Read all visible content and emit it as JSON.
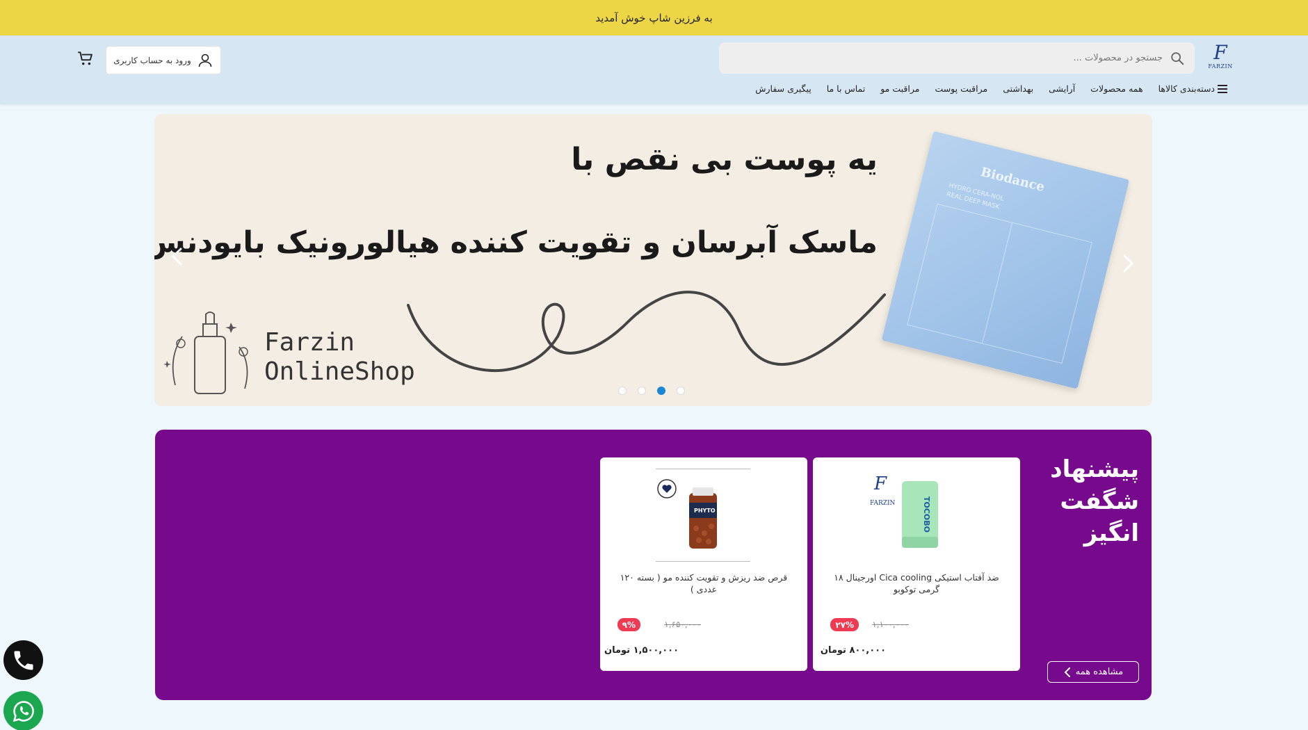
{
  "topbar": {
    "welcome": "به فرزین شاپ خوش آمدید"
  },
  "header": {
    "logo_mark": "F",
    "logo_text": "FARZIN",
    "search_placeholder": "جستجو در محصولات ...",
    "login_label": "ورود به حساب کاربری"
  },
  "nav": {
    "items": [
      {
        "label": "دسته‌بندی کالاها"
      },
      {
        "label": "همه محصولات"
      },
      {
        "label": "آرایشی"
      },
      {
        "label": "بهداشتی"
      },
      {
        "label": "مراقبت پوست"
      },
      {
        "label": "مراقبت مو"
      },
      {
        "label": "تماس با ما"
      },
      {
        "label": "پیگیری سفارش"
      }
    ]
  },
  "hero": {
    "line1": "یه پوست بی نقص با",
    "line2": "ماسک آبرسان و تقویت کننده هیالورونیک بایودنس",
    "shop_line1": "Farzin",
    "shop_line2": "OnlineShop",
    "mask_brand": "Biodance",
    "mask_sub1": "HYDRO CERA-NOL",
    "mask_sub2": "REAL DEEP MASK",
    "active_slide": 3,
    "slide_count": 4
  },
  "offer": {
    "title": "پیشنهاد شگفت انگیز",
    "see_all": "مشاهده همه",
    "products": [
      {
        "name": "ضد آفتاب استیکی Cica cooling اورجینال ۱۸ گرمی توکوبو",
        "discount": "۲۷%",
        "old_price": "۱,۱۰۰,۰۰۰",
        "price": "۸۰۰,۰۰۰ تومان",
        "product_brand": "TOCOBO",
        "logo_text": "FARZIN"
      },
      {
        "name": "قرص ضد ریزش و تقویت کننده مو ( بسته ۱۲۰ عددی )",
        "discount": "۹%",
        "old_price": "۱,۶۵۰,۰۰۰",
        "price": "۱,۵۰۰,۰۰۰ تومان",
        "product_brand": "PHYTO"
      }
    ]
  },
  "colors": {
    "topbar": "#ecd646",
    "header": "#d6e6f2",
    "offer_bg": "#770a8c",
    "discount": "#ef3a53",
    "dot_active": "#1a86d6"
  }
}
